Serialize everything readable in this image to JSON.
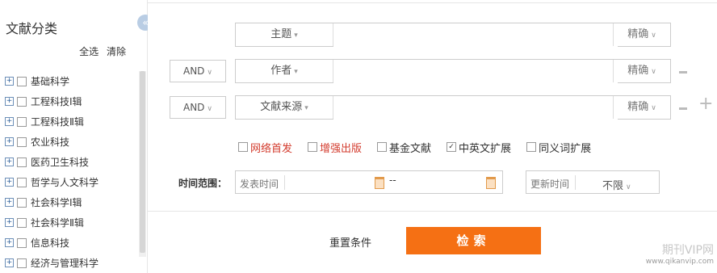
{
  "sidebar": {
    "title": "文献分类",
    "collapse_icon": "«",
    "select_all": "全选",
    "clear": "清除",
    "expand_symbol": "+",
    "items": [
      {
        "label": "基础科学"
      },
      {
        "label": "工程科技Ⅰ辑"
      },
      {
        "label": "工程科技Ⅱ辑"
      },
      {
        "label": "农业科技"
      },
      {
        "label": "医药卫生科技"
      },
      {
        "label": "哲学与人文科学"
      },
      {
        "label": "社会科学Ⅰ辑"
      },
      {
        "label": "社会科学Ⅱ辑"
      },
      {
        "label": "信息科技"
      },
      {
        "label": "经济与管理科学"
      }
    ]
  },
  "search": {
    "rows": [
      {
        "logic": "",
        "field": "主题",
        "match": "精确"
      },
      {
        "logic": "AND",
        "field": "作者",
        "match": "精确"
      },
      {
        "logic": "AND",
        "field": "文献来源",
        "match": "精确"
      }
    ],
    "caret": "▾",
    "logic_caret": "∨",
    "match_caret": "∨"
  },
  "options": {
    "network_first": "网络首发",
    "enhanced_pub": "增强出版",
    "fund": "基金文献",
    "cn_en_expand": "中英文扩展",
    "synonym_expand": "同义词扩展",
    "cn_en_checked_mark": "✓"
  },
  "time": {
    "label": "时间范围：",
    "publish_placeholder": "发表时间",
    "dash": "--",
    "update_label": "更新时间",
    "update_value": "不限",
    "update_caret": "∨"
  },
  "actions": {
    "reset": "重置条件",
    "search": "检索"
  },
  "watermark": {
    "top": "期刊VIP网",
    "bottom": "www.qikanvip.com"
  },
  "colors": {
    "accent": "#f57014",
    "red_option": "#d33b2d",
    "calendar": "#e29a4b"
  }
}
